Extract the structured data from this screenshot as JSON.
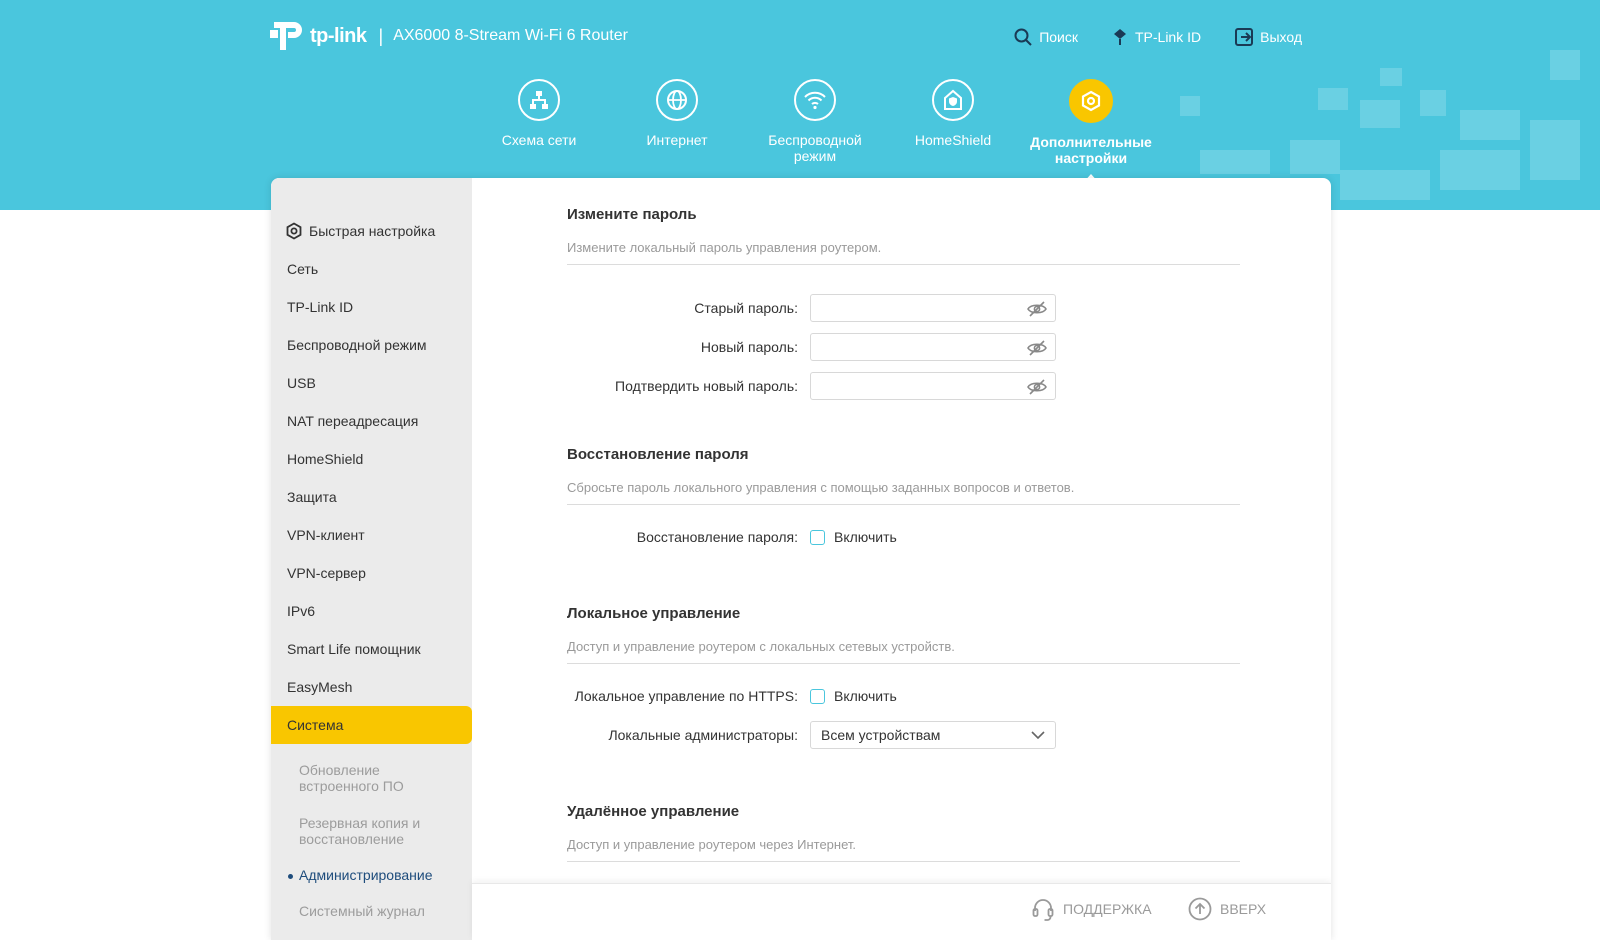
{
  "header": {
    "brand": "tp-link",
    "model": "AX6000 8-Stream Wi-Fi 6 Router",
    "nav": [
      {
        "label": "Поиск",
        "icon": "search-icon"
      },
      {
        "label": "TP-Link ID",
        "icon": "tplink-id-icon"
      },
      {
        "label": "Выход",
        "icon": "logout-icon"
      }
    ],
    "tabs": [
      {
        "label": "Схема сети",
        "icon": "network-map-icon"
      },
      {
        "label": "Интернет",
        "icon": "globe-icon"
      },
      {
        "label": "Беспроводной\nрежим",
        "icon": "wifi-icon"
      },
      {
        "label": "HomeShield",
        "icon": "homeshield-icon"
      },
      {
        "label": "Дополнительные\nнастройки",
        "icon": "gear-icon",
        "active": true
      }
    ]
  },
  "sidebar": {
    "quick_setup": "Быстрая настройка",
    "items": [
      "Сеть",
      "TP-Link ID",
      "Беспроводной режим",
      "USB",
      "NAT переадресация",
      "HomeShield",
      "Защита",
      "VPN-клиент",
      "VPN-сервер",
      "IPv6",
      "Smart Life помощник",
      "EasyMesh"
    ],
    "active_item": "Система",
    "sub_items": [
      "Обновление встроенного ПО",
      "Резервная копия и восстановление",
      "Администрирование",
      "Системный журнал"
    ],
    "active_sub": "Администрирование"
  },
  "change_password": {
    "title": "Измените пароль",
    "desc": "Измените локальный пароль управления роутером.",
    "old_label": "Старый пароль:",
    "new_label": "Новый пароль:",
    "confirm_label": "Подтвердить новый пароль:",
    "old_value": "",
    "new_value": "",
    "confirm_value": ""
  },
  "recovery": {
    "title": "Восстановление пароля",
    "desc": "Сбросьте пароль локального управления с помощью заданных вопросов и ответов.",
    "label": "Восстановление пароля:",
    "checkbox_label": "Включить",
    "enabled": false
  },
  "local_mgmt": {
    "title": "Локальное управление",
    "desc": "Доступ и управление роутером с локальных сетевых устройств.",
    "https_label": "Локальное управление по HTTPS:",
    "https_checkbox_label": "Включить",
    "https_enabled": false,
    "admins_label": "Локальные администраторы:",
    "admins_value": "Всем устройствам"
  },
  "remote_mgmt": {
    "title": "Удалённое управление",
    "desc": "Доступ и управление роутером через Интернет."
  },
  "footer": {
    "support": "ПОДДЕРЖКА",
    "top": "ВВЕРХ"
  },
  "colors": {
    "header_bg": "#4ac6dd",
    "accent": "#f9c600",
    "active_sub": "#1e4c7c"
  }
}
